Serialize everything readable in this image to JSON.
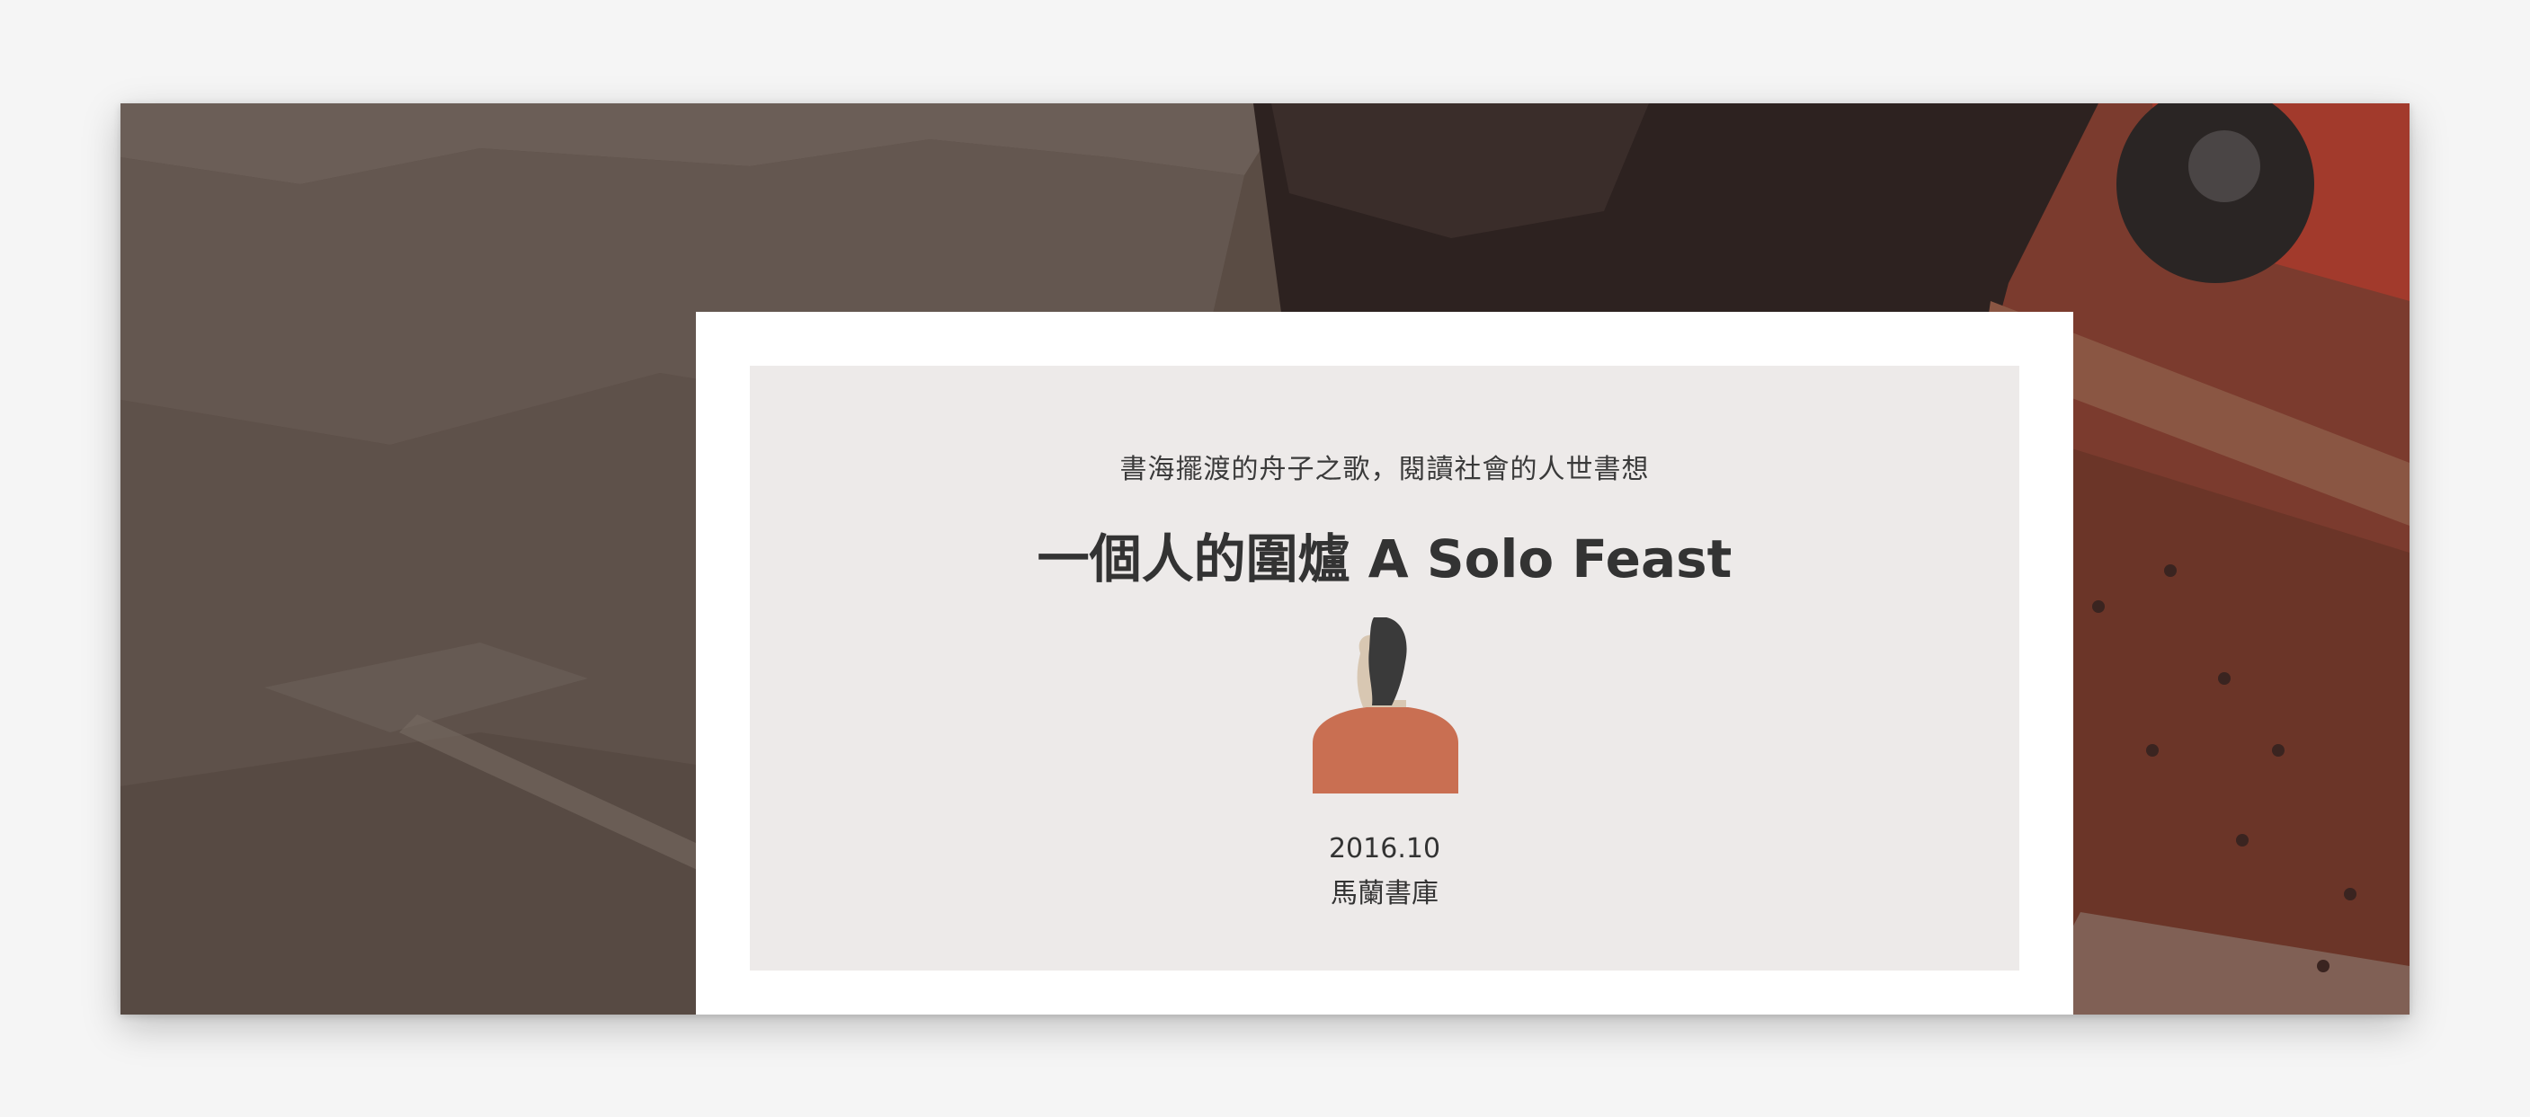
{
  "banner": {
    "subtitle": "書海擺渡的舟子之歌，閱讀社會的人世書想",
    "title": "一個人的圍爐 A Solo Feast",
    "date": "2016.10",
    "place": "馬蘭書庫",
    "figure_icon": "person-back-view-icon"
  },
  "colors": {
    "page_background": "#f5f5f5",
    "card_outer": "#ffffff",
    "card_inner": "#edeae9",
    "text": "#333333",
    "figure_shirt": "#c96f52",
    "figure_hair": "#3a3a3a",
    "figure_skin": "#d8c7b2"
  }
}
